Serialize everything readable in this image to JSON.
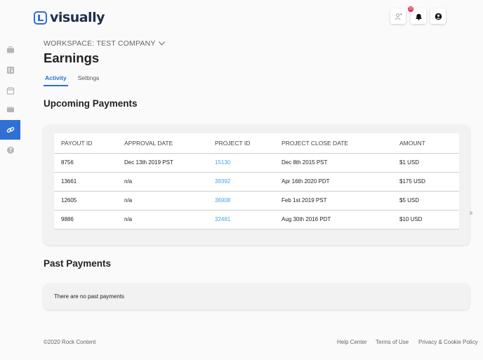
{
  "brand": {
    "name": "visually",
    "color": "#2f6fd6"
  },
  "sidebar": {
    "items": [
      {
        "icon": "briefcase-icon"
      },
      {
        "icon": "sliders-icon"
      },
      {
        "icon": "calendar-icon"
      },
      {
        "icon": "wallet-icon"
      },
      {
        "icon": "link-icon",
        "active": true
      },
      {
        "icon": "help-icon"
      }
    ]
  },
  "header": {
    "actions": [
      {
        "icon": "add-user-icon"
      },
      {
        "icon": "bell-icon",
        "badge": "20"
      },
      {
        "icon": "account-icon"
      }
    ]
  },
  "workspace": {
    "label": "WORKSPACE: TEST COMPANY"
  },
  "page": {
    "title": "Earnings"
  },
  "tabs": [
    {
      "label": "Activity",
      "active": true
    },
    {
      "label": "Settings",
      "active": false
    }
  ],
  "upcoming": {
    "title": "Upcoming Payments",
    "columns": [
      "PAYOUT ID",
      "APPROVAL DATE",
      "PROJECT ID",
      "PROJECT CLOSE DATE",
      "AMOUNT"
    ],
    "rows": [
      [
        "8756",
        "Dec 13th 2019 PST",
        "15130",
        "Dec 8th 2015 PST",
        "$1 USD"
      ],
      [
        "13661",
        "n/a",
        "39392",
        "Apr 16th 2020 PDT",
        "$175 USD"
      ],
      [
        "12605",
        "n/a",
        "36908",
        "Feb 1st 2019 PST",
        "$5 USD"
      ],
      [
        "9886",
        "n/a",
        "32481",
        "Aug 30th 2016 PDT",
        "$10 USD"
      ]
    ]
  },
  "past": {
    "title": "Past Payments",
    "empty_text": "There are no past payments"
  },
  "footer": {
    "copyright": "©2020 Rock Content",
    "links": [
      "Help Center",
      "Terms of Use",
      "Privacy & Cookie Policy"
    ]
  }
}
